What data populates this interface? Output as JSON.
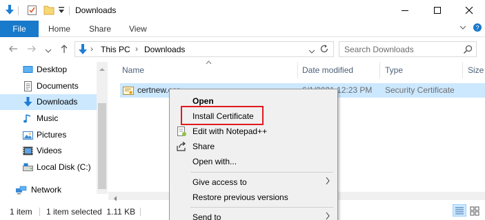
{
  "window": {
    "title": "Downloads",
    "icons": [
      "download-arrow-icon",
      "properties-checkbox-icon",
      "new-folder-icon",
      "customize-toolbar-icon"
    ],
    "controls": [
      "minimize-icon",
      "maximize-icon",
      "close-icon"
    ]
  },
  "ribbon": {
    "tabs": [
      {
        "label": "File",
        "active": true
      },
      {
        "label": "Home"
      },
      {
        "label": "Share"
      },
      {
        "label": "View"
      }
    ],
    "accent": "#1979ca"
  },
  "address": {
    "path": [
      "This PC",
      "Downloads"
    ],
    "search_placeholder": "Search Downloads"
  },
  "nav": {
    "items": [
      {
        "label": "Desktop",
        "icon": "desktop-icon"
      },
      {
        "label": "Documents",
        "icon": "documents-icon"
      },
      {
        "label": "Downloads",
        "icon": "downloads-icon",
        "selected": true
      },
      {
        "label": "Music",
        "icon": "music-icon"
      },
      {
        "label": "Pictures",
        "icon": "pictures-icon"
      },
      {
        "label": "Videos",
        "icon": "videos-icon"
      },
      {
        "label": "Local Disk (C:)",
        "icon": "local-disk-icon"
      },
      {
        "label": "Network",
        "icon": "network-icon"
      }
    ]
  },
  "columns": [
    "Name",
    "Date modified",
    "Type",
    "Size"
  ],
  "files": [
    {
      "name": "certnew.cer",
      "date": "6/1/2021 12:23 PM",
      "type": "Security Certificate",
      "icon": "certificate-icon"
    }
  ],
  "status": {
    "count": "1 item",
    "selection": "1 item selected  1.11 KB"
  },
  "context_menu": {
    "items": [
      {
        "label": "Open",
        "bold": true
      },
      {
        "label": "Install Certificate",
        "highlighted": true
      },
      {
        "label": "Edit with Notepad++",
        "icon": "notepad-plus-plus-icon"
      },
      {
        "label": "Share",
        "icon": "share-icon"
      },
      {
        "label": "Open with..."
      },
      {
        "label": "Give access to",
        "submenu": true
      },
      {
        "label": "Restore previous versions"
      },
      {
        "label": "Send to",
        "submenu": true
      }
    ],
    "highlight_color": "#e3171c"
  }
}
